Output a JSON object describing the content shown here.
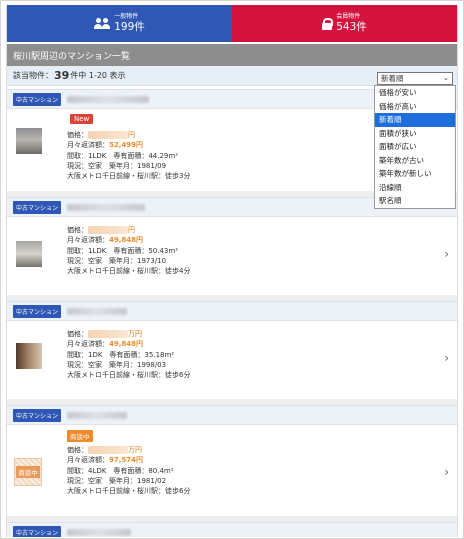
{
  "tabs": {
    "general": {
      "label": "一般物件",
      "count": "199件"
    },
    "member": {
      "label": "会員物件",
      "count": "543件"
    }
  },
  "section_title": "桜川駅周辺のマンション一覧",
  "result": {
    "prefix": "該当物件：",
    "count": "39",
    "suffix": "件中 1-20 表示"
  },
  "sort": {
    "selected": "新着順",
    "options": [
      "価格が安い",
      "価格が高い",
      "新着順",
      "面積が狭い",
      "面積が広い",
      "築年数が古い",
      "築年数が新しい",
      "沿線順",
      "駅名順"
    ]
  },
  "listings": [
    {
      "badge": "中古マンション",
      "tag": "New",
      "price_label": "価格：",
      "price_unit": "円",
      "loan_label": "月々返済額：",
      "loan": "52,499円",
      "layout": "間取：1LDK　専有面積：44.29m²",
      "status": "現況：空家　築年月：1981/09",
      "access": "大阪メトロ千日前線・桜川駅：徒歩3分"
    },
    {
      "badge": "中古マンション",
      "tag": "",
      "price_label": "価格：",
      "price_unit": "円",
      "loan_label": "月々返済額：",
      "loan": "49,848円",
      "layout": "間取：1LDK　専有面積：50.43m²",
      "status": "現況：空家　築年月：1973/10",
      "access": "大阪メトロ千日前線・桜川駅：徒歩4分"
    },
    {
      "badge": "中古マンション",
      "tag": "",
      "price_label": "価格：",
      "price_unit": "万円",
      "loan_label": "月々返済額：",
      "loan": "49,848円",
      "layout": "間取：1DK　専有面積：35.18m²",
      "status": "現況：空家　築年月：1998/03",
      "access": "大阪メトロ千日前線・桜川駅：徒歩6分"
    },
    {
      "badge": "中古マンション",
      "tag": "商談中",
      "thumb_label": "商談中",
      "price_label": "価格：",
      "price_unit": "万円",
      "loan_label": "月々返済額：",
      "loan": "97,574円",
      "layout": "間取：4LDK　専有面積：80.4m²",
      "status": "現況：空家　築年月：1981/02",
      "access": "大阪メトロ千日前線・桜川駅：徒歩6分"
    },
    {
      "badge": "中古マンション"
    }
  ]
}
